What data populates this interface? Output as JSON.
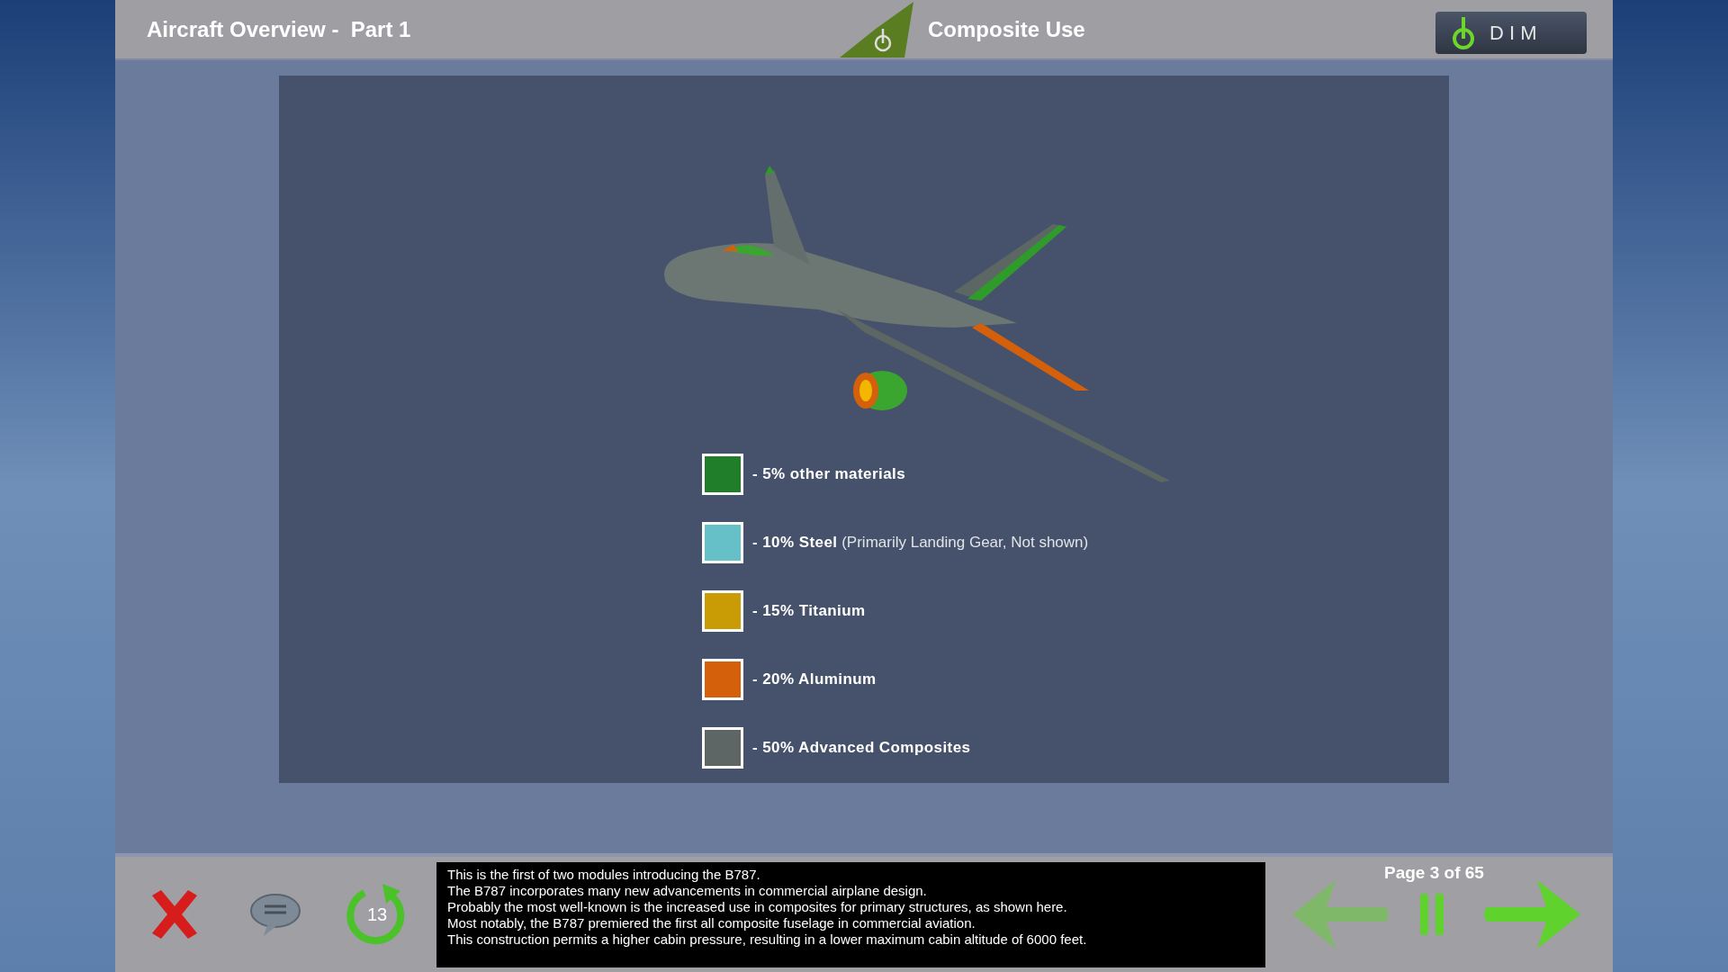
{
  "header": {
    "title": "Aircraft Overview -  Part 1",
    "slide_title": "Composite Use",
    "dim_button": "D I M"
  },
  "legend": [
    {
      "label": "- 5% other materials",
      "color": "#207e2b"
    },
    {
      "label": "- 10% Steel",
      "note": "(Primarily Landing Gear, Not shown)",
      "color": "#66c0c8"
    },
    {
      "label": "- 15% Titanium",
      "color": "#c99c06"
    },
    {
      "label": "- 20% Aluminum",
      "color": "#d5600c"
    },
    {
      "label": "- 50% Advanced Composites",
      "color": "#5d6665"
    }
  ],
  "controls": {
    "replay_count": "13",
    "back_disabled": true,
    "page": "Page 3 of 65"
  },
  "caption": [
    "This is the first of two modules introducing the B787.",
    "The B787 incorporates many new advancements in commercial airplane design.",
    "Probably the most well-known is the increased use in composites for primary structures, as shown here.",
    "Most notably, the B787 premiered the first all composite fuselage in commercial aviation.",
    "This construction permits a higher cabin pressure, resulting in a lower maximum cabin altitude of 6000 feet."
  ]
}
